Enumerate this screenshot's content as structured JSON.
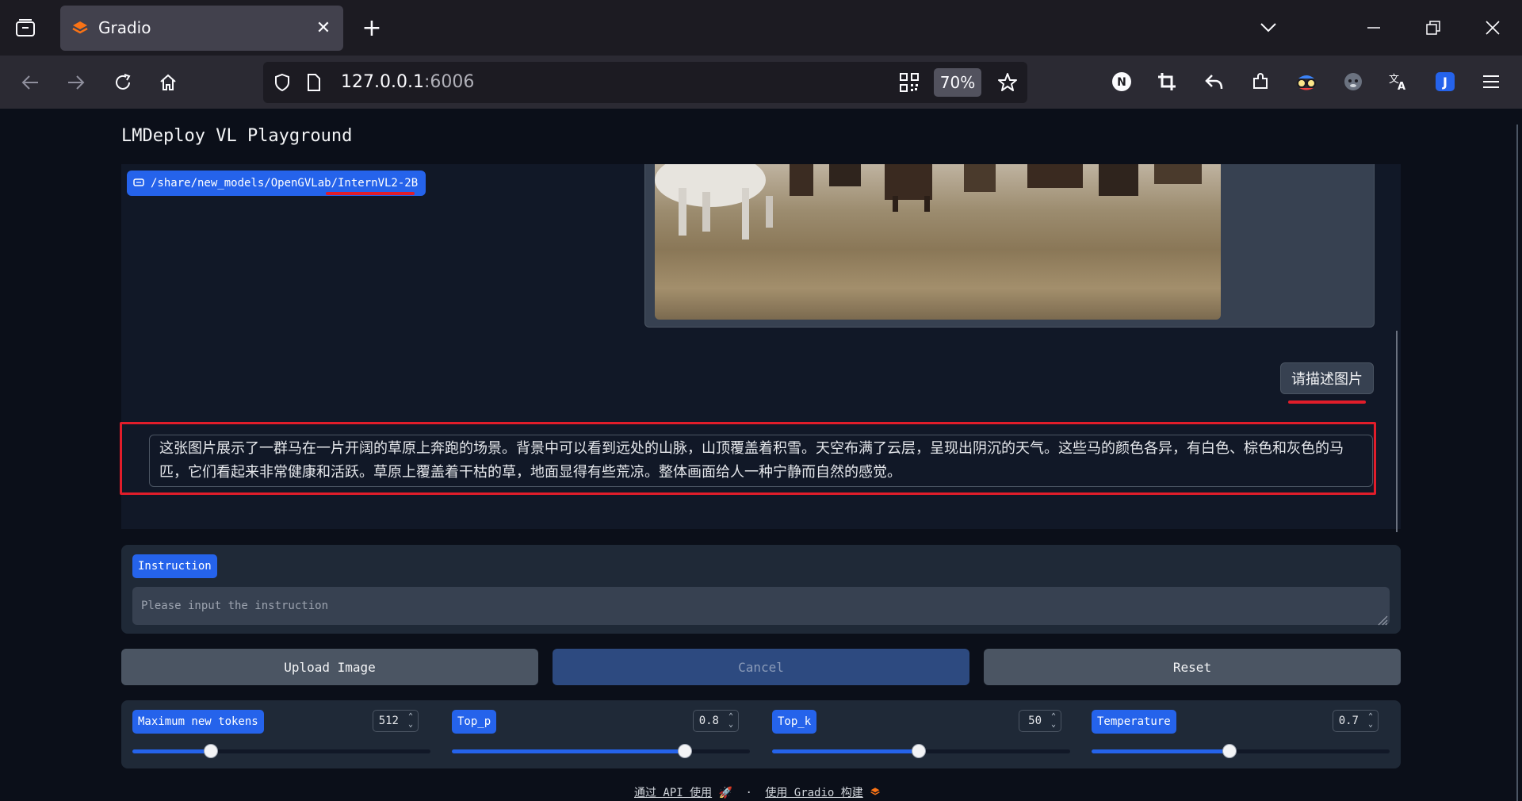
{
  "browser": {
    "tab_title": "Gradio",
    "url_host": "127.0.0.1",
    "url_port": ":6006",
    "zoom": "70%"
  },
  "app": {
    "title": "LMDeploy VL Playground",
    "model_path": "/share/new_models/OpenGVLab/InternVL2-2B",
    "user_message": "请描述图片",
    "bot_reply": "这张图片展示了一群马在一片开阔的草原上奔跑的场景。背景中可以看到远处的山脉，山顶覆盖着积雪。天空布满了云层，呈现出阴沉的天气。这些马的颜色各异，有白色、棕色和灰色的马匹，它们看起来非常健康和活跃。草原上覆盖着干枯的草，地面显得有些荒凉。整体画面给人一种宁静而自然的感觉。"
  },
  "instruction": {
    "label": "Instruction",
    "placeholder": "Please input the instruction",
    "value": ""
  },
  "buttons": {
    "upload": "Upload Image",
    "cancel": "Cancel",
    "reset": "Reset"
  },
  "sliders": [
    {
      "label": "Maximum new tokens",
      "value": "512",
      "fraction": 0.26
    },
    {
      "label": "Top_p",
      "value": "0.8",
      "fraction": 0.78
    },
    {
      "label": "Top_k",
      "value": "50",
      "fraction": 0.49
    },
    {
      "label": "Temperature",
      "value": "0.7",
      "fraction": 0.46
    }
  ],
  "footer": {
    "api": "通过 API 使用",
    "sep": "·",
    "built": "使用 Gradio 构建"
  },
  "colors": {
    "accent": "#2563eb",
    "annotation_red": "#e11d2a",
    "page_bg": "#0b0f19",
    "panel_bg": "#1f2937"
  }
}
